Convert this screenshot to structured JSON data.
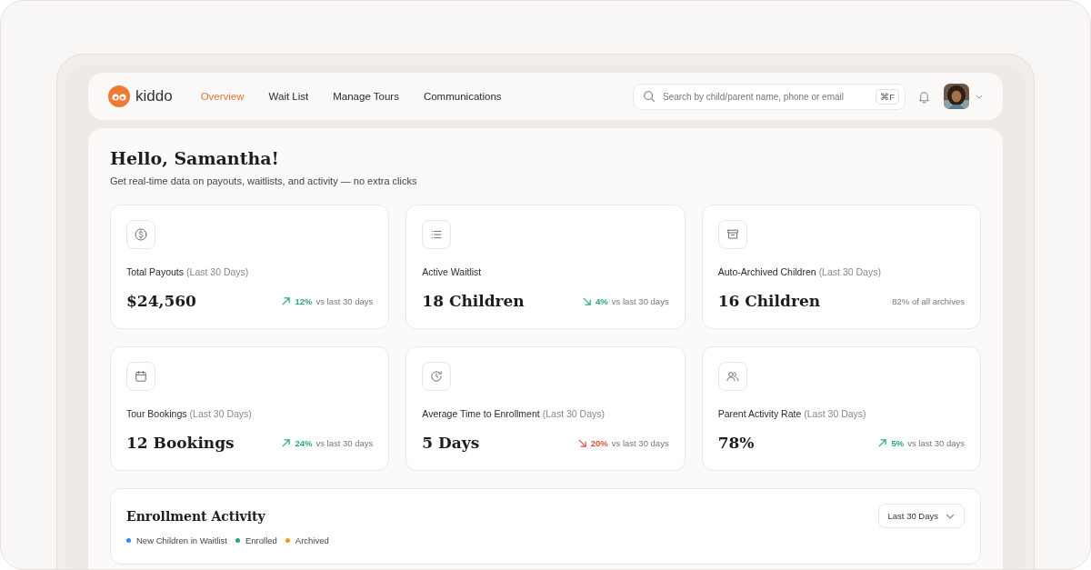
{
  "brand": {
    "name": "kiddo"
  },
  "nav": [
    {
      "label": "Overview",
      "selected": true
    },
    {
      "label": "Wait List",
      "selected": false
    },
    {
      "label": "Manage Tours",
      "selected": false
    },
    {
      "label": "Communications",
      "selected": false
    }
  ],
  "search": {
    "placeholder": "Search by child/parent name, phone or email",
    "shortcut": "⌘F"
  },
  "greeting": {
    "title": "Hello, Samantha!",
    "subtitle": "Get real-time data on payouts, waitlists, and activity — no extra clicks"
  },
  "stats": [
    {
      "label": "Total Payouts",
      "period": "(Last 30 Days)",
      "value": "$24,560",
      "change": {
        "kind": "up",
        "percent": "12%",
        "note": "vs last 30 days"
      }
    },
    {
      "label": "Active Waitlist",
      "value": "18 Children",
      "change": {
        "kind": "down_good",
        "percent": "4%",
        "note": "vs last 30 days"
      }
    },
    {
      "label": "Auto-Archived Children",
      "period": "(Last 30 Days)",
      "value": "16 Children",
      "note": "82% of all archives"
    },
    {
      "label": "Tour Bookings",
      "period": "(Last 30 Days)",
      "value": "12 Bookings",
      "change": {
        "kind": "up",
        "percent": "24%",
        "note": "vs last 30 days"
      }
    },
    {
      "label": "Average Time to Enrollment",
      "period": "(Last 30 Days)",
      "value": "5 Days",
      "change": {
        "kind": "down",
        "percent": "20%",
        "note": "vs last 30 days"
      }
    },
    {
      "label": "Parent Activity Rate",
      "period": "(Last 30 Days)",
      "value": "78%",
      "change": {
        "kind": "up",
        "percent": "5%",
        "note": "vs last 30 days"
      }
    }
  ],
  "activity": {
    "title": "Enrollment Activity",
    "range": "Last 30 Days",
    "legend": [
      {
        "label": "New Children in Waitlist",
        "color": "#3b82f6"
      },
      {
        "label": "Enrolled",
        "color": "#22a86b"
      },
      {
        "label": "Archived",
        "color": "#f29a1c"
      }
    ]
  }
}
